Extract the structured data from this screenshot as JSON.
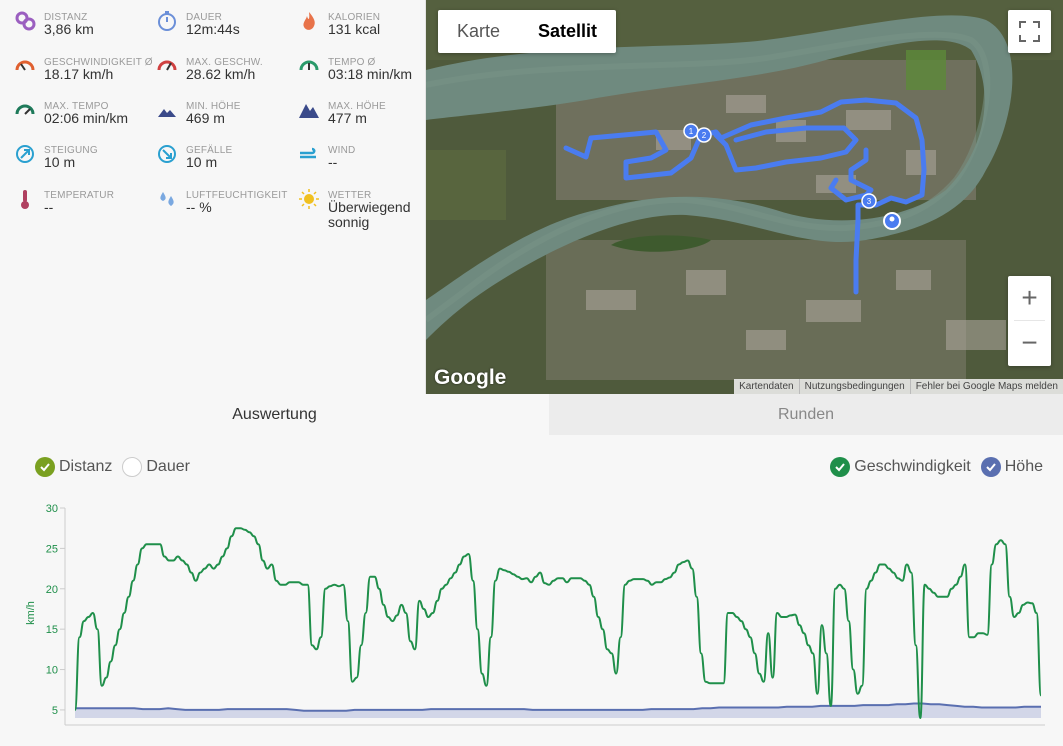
{
  "stats": [
    {
      "label": "DISTANZ",
      "value": "3,86 km",
      "icon": "distance-pin-icon",
      "color": "#9b5fc0"
    },
    {
      "label": "DAUER",
      "value": "12m:44s",
      "icon": "stopwatch-icon",
      "color": "#6b8fd8"
    },
    {
      "label": "KALORIEN",
      "value": "131 kcal",
      "icon": "flame-icon",
      "color": "#e8734a"
    },
    {
      "label": "GESCHWINDIGKEIT Ø",
      "value": "18.17 km/h",
      "icon": "speedometer-icon",
      "color": "#e06030"
    },
    {
      "label": "MAX. GESCHW.",
      "value": "28.62 km/h",
      "icon": "speedometer-max-icon",
      "color": "#d04040"
    },
    {
      "label": "TEMPO Ø",
      "value": "03:18 min/km",
      "icon": "pace-gauge-icon",
      "color": "#2a9a6a"
    },
    {
      "label": "MAX. TEMPO",
      "value": "02:06 min/km",
      "icon": "pace-gauge-max-icon",
      "color": "#1e7a5a"
    },
    {
      "label": "MIN. HÖHE",
      "value": "469 m",
      "icon": "mountain-low-icon",
      "color": "#3a4a8a"
    },
    {
      "label": "MAX. HÖHE",
      "value": "477 m",
      "icon": "mountain-high-icon",
      "color": "#3a4a8a"
    },
    {
      "label": "STEIGUNG",
      "value": "10 m",
      "icon": "ascent-arrow-icon",
      "color": "#2aa0d0"
    },
    {
      "label": "GEFÄLLE",
      "value": "10 m",
      "icon": "descent-arrow-icon",
      "color": "#2aa0d0"
    },
    {
      "label": "WIND",
      "value": "--",
      "icon": "wind-icon",
      "color": "#2aa0d0"
    },
    {
      "label": "TEMPERATUR",
      "value": "--",
      "icon": "thermometer-icon",
      "color": "#b04060"
    },
    {
      "label": "LUFTFEUCHTIGKEIT",
      "value": "-- %",
      "icon": "humidity-drops-icon",
      "color": "#7aa8e0"
    },
    {
      "label": "WETTER",
      "value": "Überwiegend sonnig",
      "icon": "sun-icon",
      "color": "#f0c020"
    }
  ],
  "map": {
    "type_map": "Karte",
    "type_satellite": "Satellit",
    "logo": "Google",
    "attribution": [
      "Kartendaten",
      "Nutzungsbedingungen",
      "Fehler bei Google Maps melden"
    ],
    "zoom_in": "+",
    "zoom_out": "−",
    "markers": [
      "1",
      "2",
      "3"
    ],
    "route_color": "#4a7cf0"
  },
  "tabs": {
    "evaluation": "Auswertung",
    "laps": "Runden"
  },
  "legend": {
    "distance": "Distanz",
    "duration": "Dauer",
    "speed": "Geschwindigkeit",
    "altitude": "Höhe"
  },
  "colors": {
    "speed": "#1f8f4a",
    "altitude": "#5a6fb0",
    "altitude_fill": "#d2d6e8",
    "distance_check": "#7aa020"
  },
  "chart_data": {
    "type": "line",
    "ylabel": "km/h",
    "ylim": [
      4,
      30
    ],
    "yticks": [
      5,
      10,
      15,
      20,
      25,
      30
    ],
    "series": [
      {
        "name": "Geschwindigkeit",
        "values": [
          5,
          14,
          16,
          16.5,
          17,
          15,
          8,
          9,
          11,
          13,
          15,
          17,
          19,
          21,
          23,
          25,
          25.5,
          25.5,
          25.5,
          25.5,
          24,
          23.5,
          23.5,
          24,
          23.5,
          23,
          22,
          21,
          22,
          22.5,
          23,
          22.5,
          23,
          24,
          25,
          26.5,
          27.5,
          27.5,
          27.3,
          27,
          26.5,
          25.5,
          23.5,
          22.5,
          23,
          21,
          20.5,
          20.5,
          20.8,
          20.8,
          20.8,
          20.5,
          20.5,
          13,
          12.5,
          14,
          20,
          20.3,
          20.5,
          20.3,
          20.5,
          16,
          8.5,
          9,
          13,
          17,
          21.5,
          21.5,
          20,
          18,
          16.5,
          16,
          16.7,
          18,
          17,
          13.5,
          12.5,
          18.5,
          17.5,
          16.5,
          17,
          18.5,
          20,
          20.5,
          21.3,
          22,
          23,
          24,
          24.3,
          21,
          15,
          9.5,
          8,
          14,
          21,
          22.5,
          22.3,
          22.1,
          21.8,
          21.5,
          21.2,
          21.3,
          20.8,
          21.5,
          22,
          20.7,
          20.5,
          21,
          21.3,
          21.3,
          20.8,
          21.3,
          21.3,
          21.3,
          21,
          20.5,
          19,
          16.5,
          15,
          12.5,
          12,
          9.5,
          14,
          20.5,
          21,
          21.2,
          21.2,
          21.2,
          21,
          20.5,
          20.8,
          20.8,
          21.2,
          21.4,
          22,
          23,
          23.3,
          23.5,
          22.5,
          19,
          12,
          8.5,
          8.3,
          8.3,
          8.3,
          8.3,
          17,
          17,
          16.5,
          16,
          15,
          14,
          12,
          9.5,
          8.5,
          14.5,
          9,
          17,
          16.5,
          16.5,
          16.7,
          16.8,
          15.5,
          14.5,
          13,
          12,
          7,
          15.5,
          12,
          5.5,
          20,
          20.5,
          20,
          16,
          10,
          7,
          8,
          20,
          21,
          22,
          23,
          23,
          22.5,
          22,
          21.3,
          21,
          23,
          22,
          13,
          4,
          20.5,
          20,
          19.5,
          19,
          19,
          19,
          20,
          20.5,
          21.5,
          23,
          14,
          14,
          14.5,
          14.5,
          14.3,
          23,
          25.5,
          26,
          25.5,
          19,
          16.5,
          17,
          18,
          18.3,
          18.2,
          17,
          6.8
        ]
      },
      {
        "name": "Höhe",
        "values": [
          5.2,
          5.2,
          5.2,
          5.2,
          5.2,
          5.2,
          5.2,
          5.2,
          5.1,
          5.1,
          5.1,
          5.2,
          5.1,
          5.0,
          5.0,
          5.0,
          5.0,
          5.0,
          5.1,
          5.1,
          5.1,
          5.1,
          5.1,
          5.1,
          5.1,
          5.1,
          5.0,
          4.9,
          4.9,
          4.9,
          4.9,
          4.9,
          4.9,
          5.0,
          5.0,
          5.0,
          5.0,
          5.0,
          5.0,
          5.0,
          5.0,
          5.0,
          5.1,
          5.1,
          5.1,
          5.1,
          5.1,
          5.1,
          5.1,
          5.1,
          5.1,
          5.1,
          5.1,
          5.1,
          5.0,
          5.0,
          5.0,
          5.0,
          5.0,
          5.0,
          5.0,
          5.0,
          5.0,
          5.0,
          5.0,
          5.0,
          5.0,
          5.0,
          5.1,
          5.1,
          5.1,
          5.1,
          5.1,
          5.1,
          5.2,
          5.2,
          5.3,
          5.3,
          5.3,
          5.3,
          5.3,
          5.3,
          5.3,
          5.3,
          5.4,
          5.4,
          5.4,
          5.4,
          5.5,
          5.5,
          5.5,
          5.5,
          5.5,
          5.6,
          5.6,
          5.6,
          5.6,
          5.7,
          5.7,
          5.8,
          5.8,
          5.7,
          5.7,
          5.6,
          5.5,
          5.4,
          5.4,
          5.3,
          5.3,
          5.3,
          5.3,
          5.3,
          5.4,
          5.4,
          5.4
        ]
      }
    ]
  }
}
